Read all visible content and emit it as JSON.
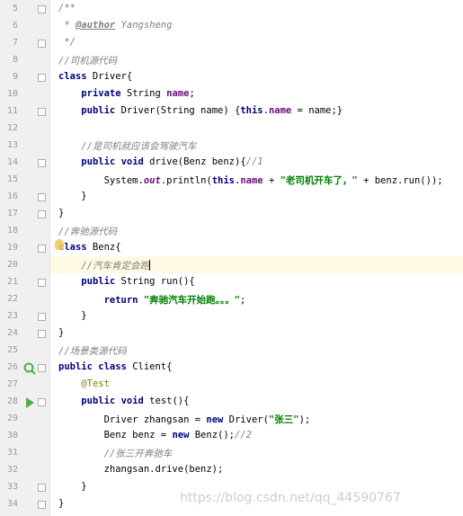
{
  "editor": {
    "lines": [
      {
        "n": "5"
      },
      {
        "n": "6"
      },
      {
        "n": "7"
      },
      {
        "n": "8"
      },
      {
        "n": "9"
      },
      {
        "n": "10"
      },
      {
        "n": "11"
      },
      {
        "n": "12"
      },
      {
        "n": "13"
      },
      {
        "n": "14"
      },
      {
        "n": "15"
      },
      {
        "n": "16"
      },
      {
        "n": "17"
      },
      {
        "n": "18"
      },
      {
        "n": "19"
      },
      {
        "n": "20"
      },
      {
        "n": "21"
      },
      {
        "n": "22"
      },
      {
        "n": "23"
      },
      {
        "n": "24"
      },
      {
        "n": "25"
      },
      {
        "n": "26"
      },
      {
        "n": "27"
      },
      {
        "n": "28"
      },
      {
        "n": "29"
      },
      {
        "n": "30"
      },
      {
        "n": "31"
      },
      {
        "n": "32"
      },
      {
        "n": "33"
      },
      {
        "n": "34"
      }
    ],
    "tokens": {
      "doc_open": "/**",
      "doc_star": " * ",
      "doc_author_tag": "@author",
      "doc_author_name": " Yangsheng",
      "doc_close": " */",
      "c_driver_src": "//司机源代码",
      "kw_class": "class",
      "driver_decl": " Driver{",
      "kw_private": "private",
      "t_string_sp": " String ",
      "f_name": "name",
      "semi": ";",
      "kw_public": "public",
      "ctor_sig": " Driver(String name) {",
      "kw_this": "this",
      "dot": ".",
      "ctor_assign": " = name;}",
      "c_drive_car": "//是司机就应该会驾驶汽车",
      "kw_void": "void",
      "drive_sig": " drive(Benz benz){",
      "c_mark1": "//1",
      "sys_prefix": "System.",
      "f_out": "out",
      "println_open": ".println(",
      "plus_sp": " + ",
      "str_driver_on": "\"老司机开车了，\"",
      "benz_run_call": " + benz.run());",
      "close_brace": "}",
      "c_benz_src": "//奔驰源代码",
      "benz_decl": " Benz{",
      "c_car_run": "//汽车肯定会跑",
      "run_sig": " String run(){",
      "kw_return": "return",
      "str_benz_run": "\"奔驰汽车开始跑。。。\"",
      "c_scene_src": "//场景类源代码",
      "client_decl": " Client{",
      "ann_test": "@Test",
      "test_sig": " test(){",
      "driver_var": "Driver zhangsan = ",
      "kw_new": "new",
      "driver_new_open": " Driver(",
      "str_zhangsan": "\"张三\"",
      "paren_semi": ");",
      "benz_var": "Benz benz = ",
      "benz_new": " Benz();",
      "c_mark2": "//2",
      "c_zhangsan_drive": "//张三开奔驰车",
      "drive_call": "zhangsan.drive(benz);"
    }
  },
  "watermark": "https://blog.csdn.net/qq_44590767"
}
